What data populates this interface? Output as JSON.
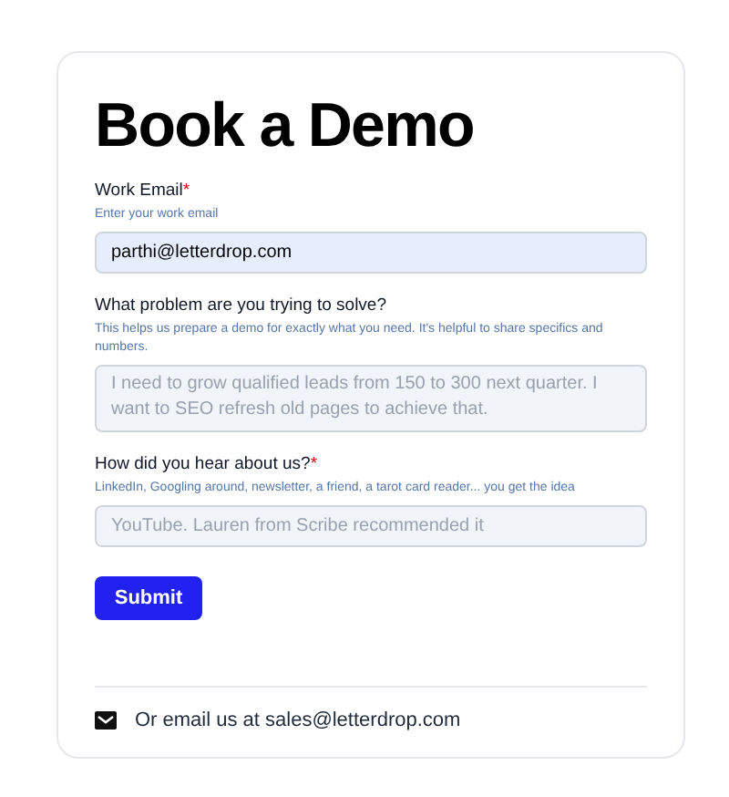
{
  "title": "Book a Demo",
  "fields": [
    {
      "kind": "input",
      "label": "Work Email",
      "required_mark": "*",
      "hint": "Enter your work email",
      "value": "parthi@letterdrop.com"
    },
    {
      "kind": "textarea",
      "label": "What problem are you trying to solve?",
      "hint": "This helps us prepare a demo for exactly what you need. It's helpful to share specifics and numbers.",
      "placeholder": "I need to grow qualified leads from 150 to 300 next quarter. I want to SEO refresh old pages to achieve that."
    },
    {
      "kind": "input",
      "label": "How did you hear about us?",
      "required_mark": "*",
      "hint": "LinkedIn, Googling around, newsletter, a friend, a tarot card reader... you get the idea",
      "placeholder": "YouTube. Lauren from Scribe recommended it"
    }
  ],
  "submit": "Submit",
  "footer": "Or email us at sales@letterdrop.com"
}
